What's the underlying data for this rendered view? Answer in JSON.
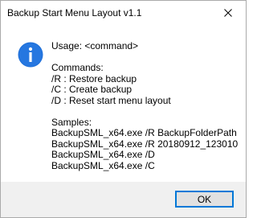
{
  "window": {
    "title": "Backup Start Menu Layout v1.1",
    "close_icon": "close-icon"
  },
  "message": {
    "icon": "info-icon",
    "usage": "Usage: <command>",
    "commands_heading": "Commands:",
    "commands": [
      "/R : Restore backup",
      "/C : Create backup",
      "/D : Reset start menu layout"
    ],
    "samples_heading": "Samples:",
    "samples": [
      "BackupSML_x64.exe /R BackupFolderPath",
      "BackupSML_x64.exe /R 20180912_123010",
      "BackupSML_x64.exe /D",
      "BackupSML_x64.exe /C"
    ]
  },
  "buttons": {
    "ok_label": "OK"
  },
  "colors": {
    "info_icon": "#1e6fd9",
    "button_focus_border": "#0078d7",
    "footer_background": "#f0f0f0"
  }
}
